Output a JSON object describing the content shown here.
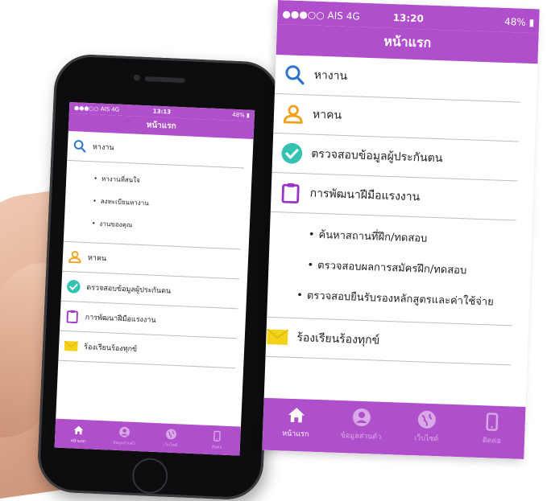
{
  "status": {
    "carrier": "●●●○○ AIS  4G",
    "time_small": "13:13",
    "time_large": "13:20",
    "battery_small": "48%",
    "battery_large": "48%"
  },
  "nav": {
    "title": "หน้าแรก"
  },
  "small_menu": {
    "find_job": "หางาน",
    "job_sub": [
      "หางานที่สนใจ",
      "ลงทะเบียนหางาน",
      "งานของคุณ"
    ],
    "find_people": "หาคน",
    "check_insured": "ตรวจสอบข้อมูลผู้ประกันตน",
    "skill_dev": "การพัฒนาฝีมือแรงงาน",
    "complaint": "ร้องเรียนร้องทุกข์"
  },
  "large_menu": {
    "find_job": "หางาน",
    "find_people": "หาคน",
    "check_insured": "ตรวจสอบข้อมูลผู้ประกันตน",
    "skill_dev": "การพัฒนาฝีมือแรงงาน",
    "skill_sub": [
      "ค้นหาสถานที่ฝึก/ทดสอบ",
      "ตรวจสอบผลการสมัครฝึก/ทดสอบ",
      "ตรวจสอบยืนรับรองหลักสูตรและค่าใช้จ่าย"
    ],
    "complaint": "ร้องเรียนร้องทุกข์"
  },
  "tabs": [
    {
      "label": "หน้าแรก",
      "icon": "home-icon"
    },
    {
      "label": "ข้อมูลส่วนตัว",
      "icon": "profile-icon"
    },
    {
      "label": "เว็บไซต์",
      "icon": "globe-icon"
    },
    {
      "label": "ติดต่อ",
      "icon": "phone-icon"
    }
  ],
  "colors": {
    "brand": "#b04fcc",
    "search": "#2f74c9",
    "person": "#f2a019",
    "check": "#35c2b1",
    "clipboard": "#9b33c9",
    "mail": "#f3d21b"
  }
}
